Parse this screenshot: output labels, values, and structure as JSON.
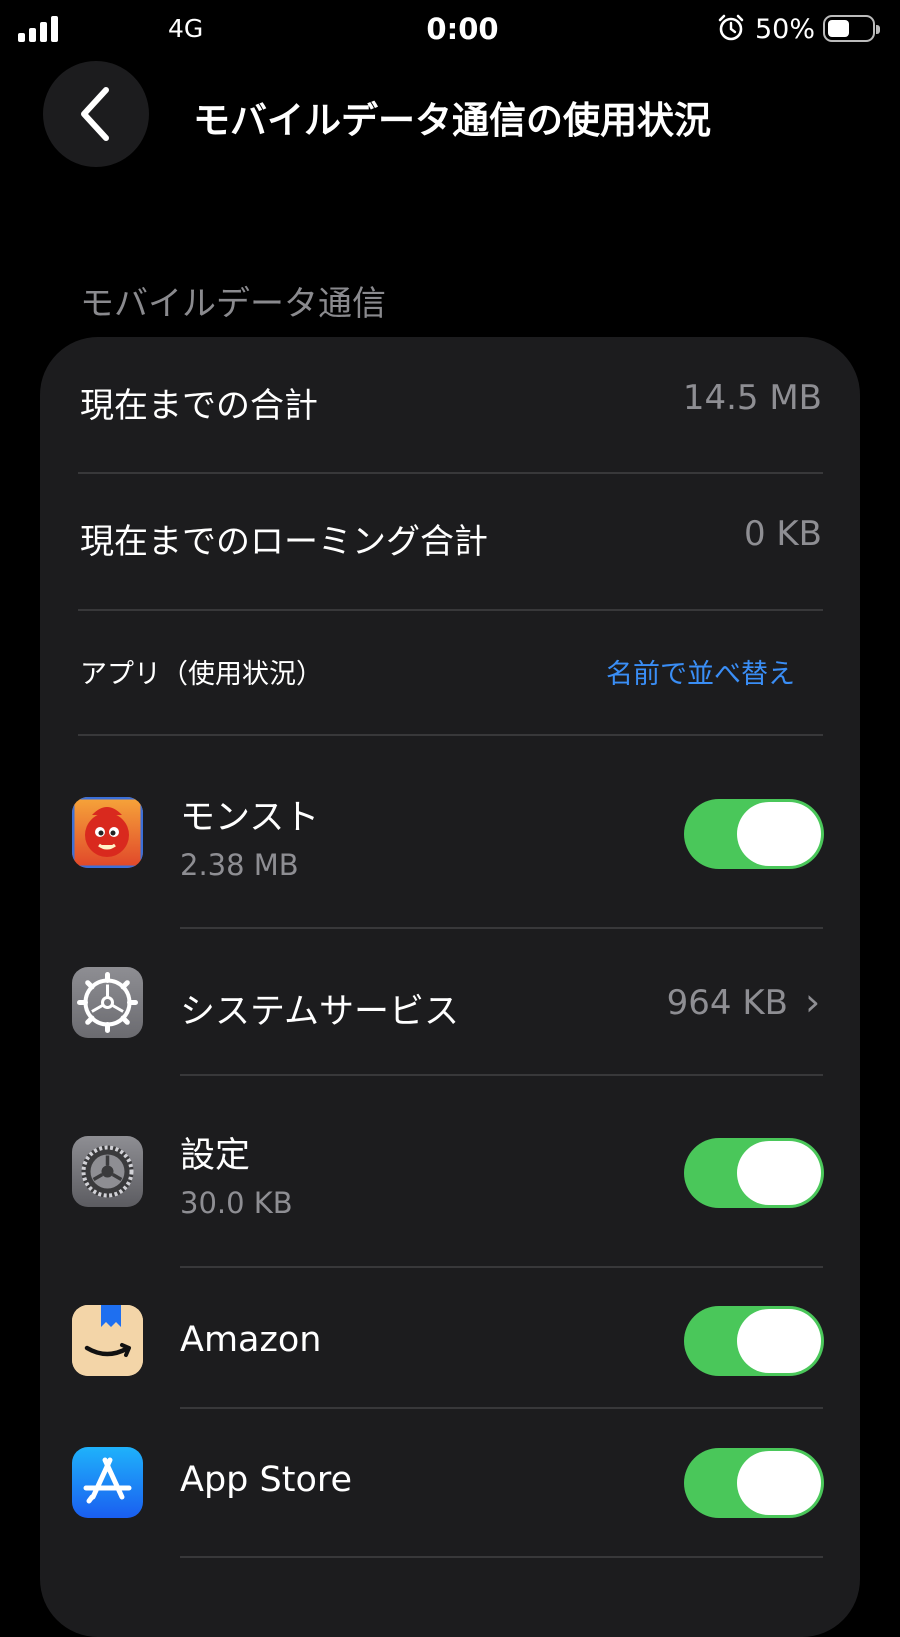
{
  "status_bar": {
    "network": "4G",
    "time": "0:00",
    "battery_percent": "50%",
    "battery_level": 0.5,
    "signal_bars": 4
  },
  "nav": {
    "title": "モバイルデータ通信の使用状況",
    "back_icon": "chevron-left-icon"
  },
  "section": {
    "header": "モバイルデータ通信"
  },
  "summary": [
    {
      "label": "現在までの合計",
      "value": "14.5 MB"
    },
    {
      "label": "現在までのローミング合計",
      "value": "0 KB"
    }
  ],
  "apps_header": {
    "label": "アプリ（使用状況）",
    "sort_link": "名前で並べ替え"
  },
  "apps": [
    {
      "name": "モンスト",
      "usage": "2.38 MB",
      "toggle": true,
      "icon": "monster-strike-icon"
    },
    {
      "name": "システムサービス",
      "value": "964 KB",
      "chevron": "›",
      "icon": "system-services-gear-icon"
    },
    {
      "name": "設定",
      "usage": "30.0 KB",
      "toggle": true,
      "icon": "settings-gear-icon"
    },
    {
      "name": "Amazon",
      "toggle": true,
      "icon": "amazon-icon"
    },
    {
      "name": "App Store",
      "toggle": true,
      "icon": "app-store-icon"
    }
  ],
  "colors": {
    "background": "#000000",
    "card": "#1c1c1e",
    "toggle_on": "#4ac75a",
    "link": "#3a8ef6",
    "secondary_text": "#8e8e93"
  }
}
